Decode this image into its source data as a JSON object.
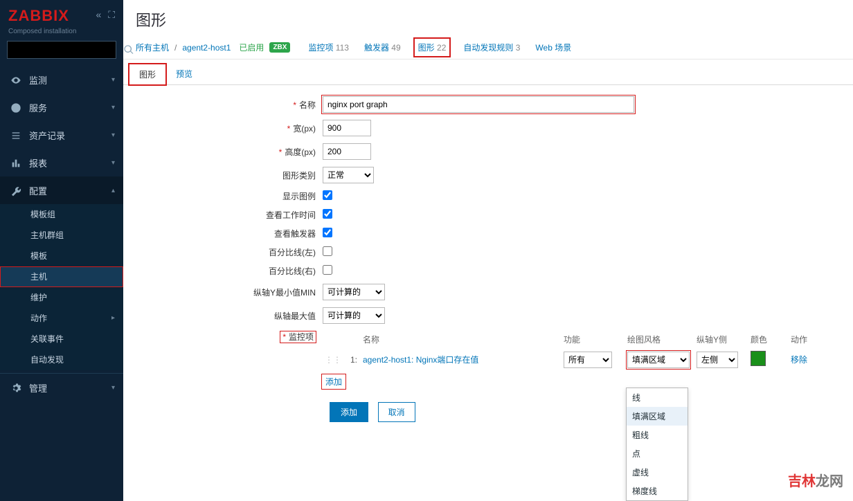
{
  "brand": "ZABBIX",
  "subtitle": "Composed installation",
  "sidebar": {
    "items": [
      {
        "label": "监测",
        "icon": "eye"
      },
      {
        "label": "服务",
        "icon": "clock"
      },
      {
        "label": "资产记录",
        "icon": "list"
      },
      {
        "label": "报表",
        "icon": "chart"
      },
      {
        "label": "配置",
        "icon": "wrench"
      },
      {
        "label": "管理",
        "icon": "gear"
      }
    ],
    "config_sub": [
      "模板组",
      "主机群组",
      "模板",
      "主机",
      "维护",
      "动作",
      "关联事件",
      "自动发现"
    ]
  },
  "page_title": "图形",
  "breadcrumb": {
    "all_hosts": "所有主机",
    "host": "agent2-host1",
    "enabled": "已启用",
    "zbx": "ZBX",
    "tabs": [
      {
        "label": "监控项",
        "count": "113"
      },
      {
        "label": "触发器",
        "count": "49"
      },
      {
        "label": "图形",
        "count": "22"
      },
      {
        "label": "自动发现规则",
        "count": "3"
      },
      {
        "label": "Web 场景",
        "count": ""
      }
    ]
  },
  "subtabs": {
    "graph": "图形",
    "preview": "预览"
  },
  "form": {
    "name_label": "名称",
    "name_value": "nginx port graph",
    "width_label": "宽(px)",
    "width_value": "900",
    "height_label": "高度(px)",
    "height_value": "200",
    "type_label": "图形类别",
    "type_value": "正常",
    "legend_label": "显示图例",
    "worktime_label": "查看工作时间",
    "triggers_label": "查看触发器",
    "percent_left_label": "百分比线(左)",
    "percent_right_label": "百分比线(右)",
    "ymin_label": "纵轴Y最小值MIN",
    "ymin_value": "可计算的",
    "ymax_label": "纵轴最大值",
    "ymax_value": "可计算的",
    "items_label": "监控项",
    "items_head": {
      "name": "名称",
      "func": "功能",
      "style": "绘图风格",
      "axis": "纵轴Y侧",
      "color": "颜色",
      "action": "动作"
    },
    "item_row": {
      "idx": "1:",
      "name": "agent2-host1: Nginx端口存在值",
      "func": "所有",
      "style": "填满区域",
      "axis": "左侧",
      "color": "#1a8f1a",
      "remove": "移除"
    },
    "add_link": "添加",
    "btn_add": "添加",
    "btn_cancel": "取消"
  },
  "dropdown": {
    "options": [
      "线",
      "填满区域",
      "粗线",
      "点",
      "虚线",
      "梯度线"
    ],
    "selected": "填满区域"
  },
  "watermark": {
    "red": "吉林",
    "gray": "龙网"
  }
}
